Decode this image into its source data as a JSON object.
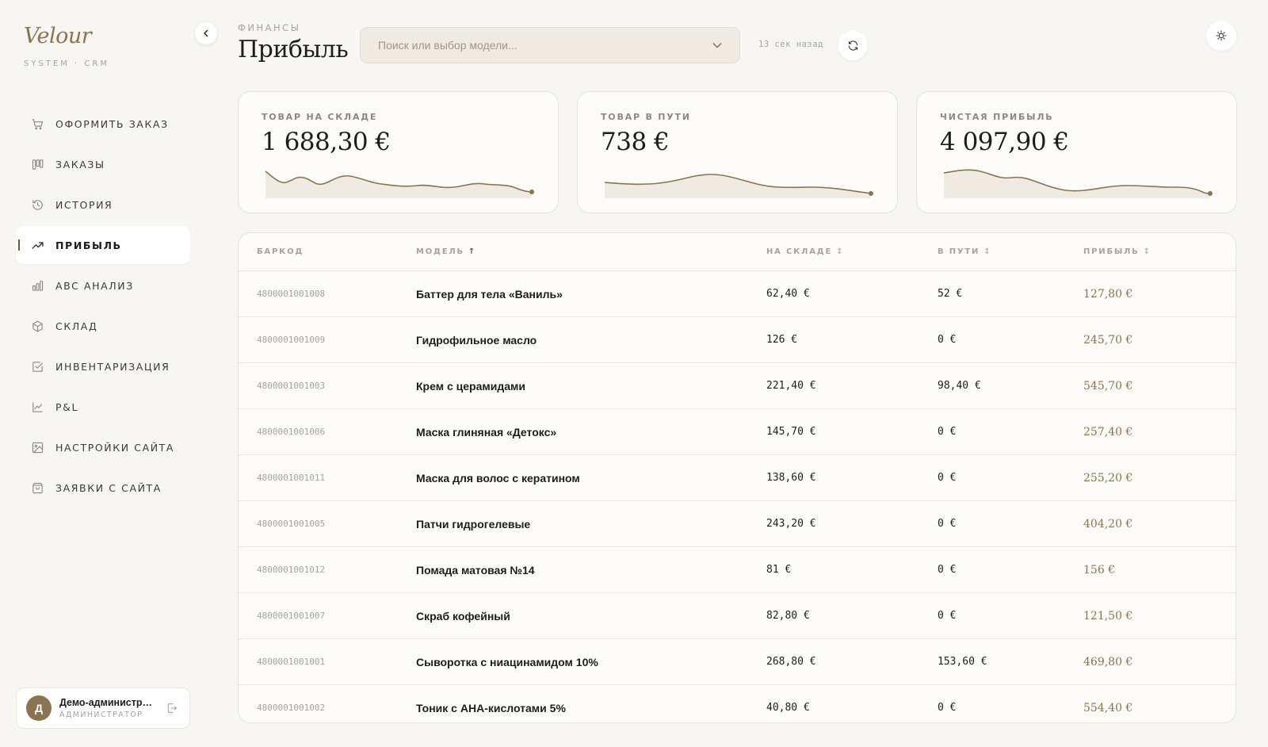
{
  "brand": {
    "name": "Velour",
    "subtitle": "SYSTEM · CRM"
  },
  "sidebar": {
    "items": [
      {
        "label": "ОФОРМИТЬ ЗАКАЗ",
        "icon": "cart-icon",
        "active": false
      },
      {
        "label": "ЗАКАЗЫ",
        "icon": "kanban-icon",
        "active": false
      },
      {
        "label": "ИСТОРИЯ",
        "icon": "history-icon",
        "active": false
      },
      {
        "label": "ПРИБЫЛЬ",
        "icon": "trending-up-icon",
        "active": true
      },
      {
        "label": "ABC АНАЛИЗ",
        "icon": "bar-chart-icon",
        "active": false
      },
      {
        "label": "СКЛАД",
        "icon": "box-icon",
        "active": false
      },
      {
        "label": "ИНВЕНТАРИЗАЦИЯ",
        "icon": "checkbox-icon",
        "active": false
      },
      {
        "label": "P&L",
        "icon": "line-chart-icon",
        "active": false
      },
      {
        "label": "НАСТРОЙКИ САЙТА",
        "icon": "image-icon",
        "active": false
      },
      {
        "label": "ЗАЯВКИ С САЙТА",
        "icon": "shopping-bag-icon",
        "active": false
      }
    ]
  },
  "user": {
    "initial": "Д",
    "name": "Демо-администра...",
    "role": "АДМИНИСТРАТОР"
  },
  "header": {
    "eyebrow": "ФИНАНСЫ",
    "title": "Прибыль",
    "search_placeholder": "Поиск или выбор модели...",
    "updated": "13 сек назад"
  },
  "stats": [
    {
      "label": "ТОВАР НА СКЛАДЕ",
      "value": "1 688,30 €"
    },
    {
      "label": "ТОВАР В ПУТИ",
      "value": "738 €"
    },
    {
      "label": "ЧИСТАЯ ПРИБЫЛЬ",
      "value": "4 097,90 €"
    }
  ],
  "table": {
    "columns": [
      {
        "label": "БАРКОД",
        "sort": ""
      },
      {
        "label": "МОДЕЛЬ",
        "sort": "↑"
      },
      {
        "label": "НА СКЛАДЕ",
        "sort": "↕"
      },
      {
        "label": "В ПУТИ",
        "sort": "↕"
      },
      {
        "label": "ПРИБЫЛЬ",
        "sort": "↕"
      }
    ],
    "rows": [
      {
        "barcode": "4800001001008",
        "model": "Баттер для тела «Ваниль»",
        "stock": "62,40 €",
        "transit": "52 €",
        "profit": "127,80 €"
      },
      {
        "barcode": "4800001001009",
        "model": "Гидрофильное масло",
        "stock": "126 €",
        "transit": "0 €",
        "profit": "245,70 €"
      },
      {
        "barcode": "4800001001003",
        "model": "Крем с церамидами",
        "stock": "221,40 €",
        "transit": "98,40 €",
        "profit": "545,70 €"
      },
      {
        "barcode": "4800001001006",
        "model": "Маска глиняная «Детокс»",
        "stock": "145,70 €",
        "transit": "0 €",
        "profit": "257,40 €"
      },
      {
        "barcode": "4800001001011",
        "model": "Маска для волос с кератином",
        "stock": "138,60 €",
        "transit": "0 €",
        "profit": "255,20 €"
      },
      {
        "barcode": "4800001001005",
        "model": "Патчи гидрогелевые",
        "stock": "243,20 €",
        "transit": "0 €",
        "profit": "404,20 €"
      },
      {
        "barcode": "4800001001012",
        "model": "Помада матовая №14",
        "stock": "81 €",
        "transit": "0 €",
        "profit": "156 €"
      },
      {
        "barcode": "4800001001007",
        "model": "Скраб кофейный",
        "stock": "82,80 €",
        "transit": "0 €",
        "profit": "121,50 €"
      },
      {
        "barcode": "4800001001001",
        "model": "Сыворотка с ниацинамидом 10%",
        "stock": "268,80 €",
        "transit": "153,60 €",
        "profit": "469,80 €"
      },
      {
        "barcode": "4800001001002",
        "model": "Тоник с AHA-кислотами 5%",
        "stock": "40,80 €",
        "transit": "0 €",
        "profit": "554,40 €"
      }
    ]
  },
  "colors": {
    "accent": "#8a7450",
    "background": "#f7f6f2",
    "card": "#fdfcf9"
  }
}
